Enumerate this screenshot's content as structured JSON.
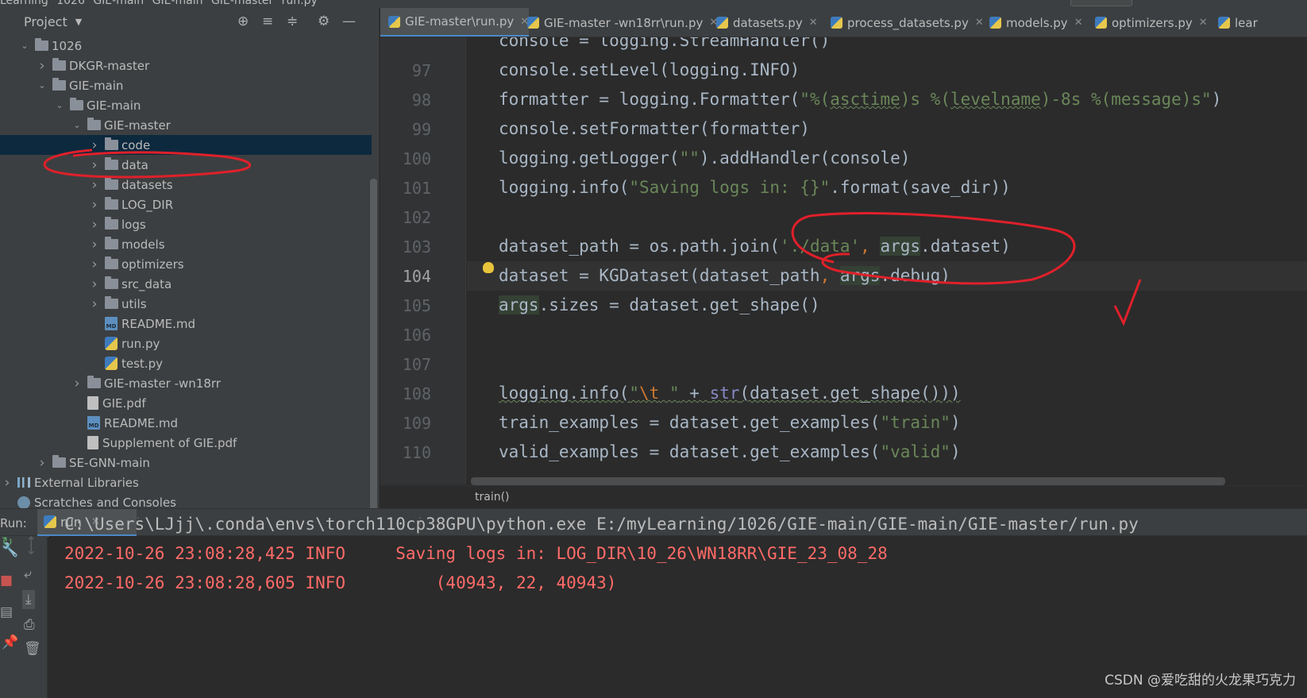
{
  "breadcrumbs": [
    "Learning",
    "1026",
    "GIE-main",
    "GIE-main",
    "GIE-master",
    "run.py"
  ],
  "run_config": "run",
  "project_panel": {
    "title": "Project",
    "tree": [
      {
        "label": "1026",
        "type": "folder",
        "indent": 1,
        "arrow": "down"
      },
      {
        "label": "DKGR-master",
        "type": "folder",
        "indent": 2,
        "arrow": "right"
      },
      {
        "label": "GIE-main",
        "type": "folder",
        "indent": 2,
        "arrow": "down"
      },
      {
        "label": "GIE-main",
        "type": "folder",
        "indent": 3,
        "arrow": "down"
      },
      {
        "label": "GIE-master",
        "type": "folder",
        "indent": 4,
        "arrow": "down"
      },
      {
        "label": "code",
        "type": "folder",
        "indent": 5,
        "arrow": "right",
        "selected": true
      },
      {
        "label": "data",
        "type": "folder",
        "indent": 5,
        "arrow": "right"
      },
      {
        "label": "datasets",
        "type": "folder",
        "indent": 5,
        "arrow": "right"
      },
      {
        "label": "LOG_DIR",
        "type": "folder",
        "indent": 5,
        "arrow": "right"
      },
      {
        "label": "logs",
        "type": "folder",
        "indent": 5,
        "arrow": "right"
      },
      {
        "label": "models",
        "type": "folder",
        "indent": 5,
        "arrow": "right"
      },
      {
        "label": "optimizers",
        "type": "folder",
        "indent": 5,
        "arrow": "right"
      },
      {
        "label": "src_data",
        "type": "folder",
        "indent": 5,
        "arrow": "right"
      },
      {
        "label": "utils",
        "type": "folder",
        "indent": 5,
        "arrow": "right"
      },
      {
        "label": "README.md",
        "type": "md",
        "indent": 5,
        "arrow": ""
      },
      {
        "label": "run.py",
        "type": "py",
        "indent": 5,
        "arrow": ""
      },
      {
        "label": "test.py",
        "type": "py",
        "indent": 5,
        "arrow": ""
      },
      {
        "label": "GIE-master -wn18rr",
        "type": "folder",
        "indent": 4,
        "arrow": "right"
      },
      {
        "label": "GIE.pdf",
        "type": "pdf",
        "indent": 4,
        "arrow": ""
      },
      {
        "label": "README.md",
        "type": "md",
        "indent": 4,
        "arrow": ""
      },
      {
        "label": "Supplement of GIE.pdf",
        "type": "pdf",
        "indent": 4,
        "arrow": ""
      },
      {
        "label": "SE-GNN-main",
        "type": "folder",
        "indent": 2,
        "arrow": "right"
      },
      {
        "label": "External Libraries",
        "type": "lib",
        "indent": 0,
        "arrow": "right"
      },
      {
        "label": "Scratches and Consoles",
        "type": "scratch",
        "indent": 0,
        "arrow": ""
      }
    ]
  },
  "editor": {
    "tabs": [
      {
        "label": "GIE-master\\run.py",
        "active": true
      },
      {
        "label": "GIE-master -wn18rr\\run.py",
        "active": false
      },
      {
        "label": "datasets.py",
        "active": false
      },
      {
        "label": "process_datasets.py",
        "active": false
      },
      {
        "label": "models.py",
        "active": false
      },
      {
        "label": "optimizers.py",
        "active": false
      },
      {
        "label": "lear",
        "active": false
      }
    ],
    "line_numbers": [
      "97",
      "98",
      "99",
      "100",
      "101",
      "102",
      "103",
      "104",
      "105",
      "106",
      "107",
      "108",
      "109",
      "110"
    ],
    "current_line": "104",
    "breadcrumb": "train()"
  },
  "run": {
    "label": "Run:",
    "tab": "run",
    "output": [
      {
        "text": "C:\\Users\\LJjj\\.conda\\envs\\torch110cp38GPU\\python.exe E:/myLearning/1026/GIE-main/GIE-main/GIE-master/run.py",
        "kind": "cmd"
      },
      {
        "text": "2022-10-26 23:08:28,425 INFO     Saving logs in: LOG_DIR\\10_26\\WN18RR\\GIE_23_08_28",
        "kind": "err"
      },
      {
        "text": "2022-10-26 23:08:28,605 INFO         (40943, 22, 40943)",
        "kind": "err"
      }
    ]
  },
  "watermark": "CSDN @爱吃甜的火龙果巧克力",
  "colors": {
    "panel_bg": "#3c3f41",
    "editor_bg": "#2b2b2b",
    "gutter_bg": "#313335",
    "keyword": "#cc7832",
    "string": "#6a8759",
    "builtin": "#8888c6",
    "error_text": "#ff6b68",
    "annotation_red": "#e0202a",
    "active_tab_underline": "#4a88c7"
  }
}
